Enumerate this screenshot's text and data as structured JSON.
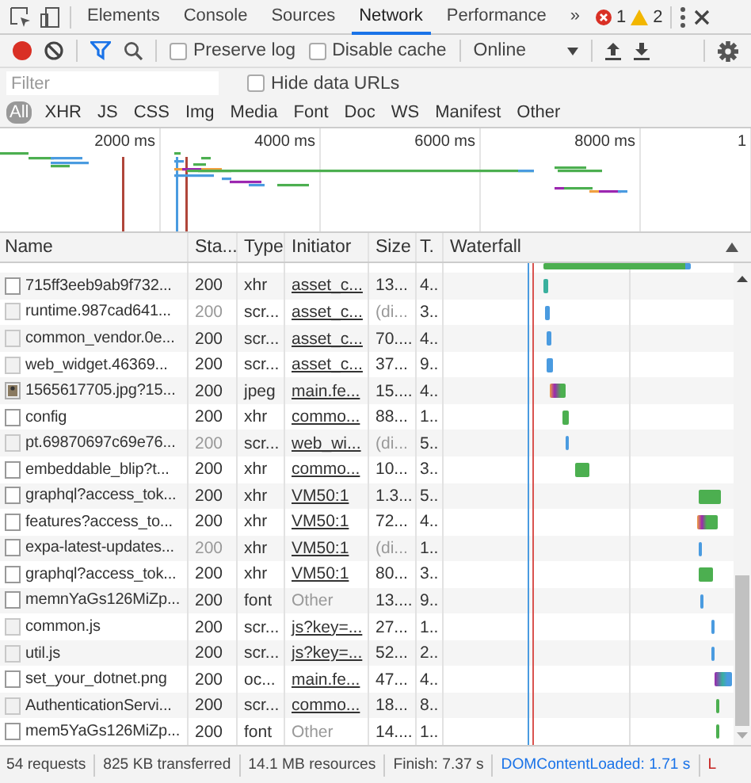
{
  "tabs": [
    {
      "label": "Elements",
      "selected": false
    },
    {
      "label": "Console",
      "selected": false
    },
    {
      "label": "Sources",
      "selected": false
    },
    {
      "label": "Network",
      "selected": true
    },
    {
      "label": "Performance",
      "selected": false
    }
  ],
  "overflow": "»",
  "errors": "1",
  "warnings": "2",
  "toolbar": {
    "recording": true,
    "filter_active": true,
    "checkboxes": [
      {
        "label": "Preserve log",
        "checked": false
      },
      {
        "label": "Disable cache",
        "checked": false
      }
    ],
    "throttling": "Online"
  },
  "filter": {
    "placeholder": "Filter",
    "hide_data_urls": {
      "label": "Hide data URLs",
      "checked": false
    }
  },
  "type_filters": [
    {
      "label": "All",
      "selected": true
    },
    {
      "label": "XHR",
      "selected": false
    },
    {
      "label": "JS",
      "selected": false
    },
    {
      "label": "CSS",
      "selected": false
    },
    {
      "label": "Img",
      "selected": false
    },
    {
      "label": "Media",
      "selected": false
    },
    {
      "label": "Font",
      "selected": false
    },
    {
      "label": "Doc",
      "selected": false
    },
    {
      "label": "WS",
      "selected": false
    },
    {
      "label": "Manifest",
      "selected": false
    },
    {
      "label": "Other",
      "selected": false
    }
  ],
  "overview": {
    "ticks": [
      "2000 ms",
      "4000 ms",
      "6000 ms",
      "8000 ms",
      "1"
    ]
  },
  "table": {
    "columns": [
      "Name",
      "Sta...",
      "Type",
      "Initiator",
      "Size",
      "T.",
      "Waterfall"
    ],
    "rows": [
      {
        "kind": "document",
        "name": "715ff3eeb9ab9f732...",
        "status": "200",
        "status_dim": false,
        "type": "xhr",
        "initiator": "asset_c...",
        "initiator_link": true,
        "size": "13...",
        "size_dim": false,
        "time": "4.."
      },
      {
        "kind": "script",
        "name": "runtime.987cad641...",
        "status": "200",
        "status_dim": true,
        "type": "scr...",
        "initiator": "asset_c...",
        "initiator_link": true,
        "size": "(di...",
        "size_dim": true,
        "time": "3.."
      },
      {
        "kind": "script",
        "name": "common_vendor.0e...",
        "status": "200",
        "status_dim": false,
        "type": "scr...",
        "initiator": "asset_c...",
        "initiator_link": true,
        "size": "70....",
        "size_dim": false,
        "time": "4.."
      },
      {
        "kind": "script",
        "name": "web_widget.46369...",
        "status": "200",
        "status_dim": false,
        "type": "scr...",
        "initiator": "asset_c...",
        "initiator_link": true,
        "size": "37...",
        "size_dim": false,
        "time": "9.."
      },
      {
        "kind": "image",
        "name": "1565617705.jpg?15...",
        "status": "200",
        "status_dim": false,
        "type": "jpeg",
        "initiator": "main.fe...",
        "initiator_link": true,
        "size": "15....",
        "size_dim": false,
        "time": "4.."
      },
      {
        "kind": "document",
        "name": "config",
        "status": "200",
        "status_dim": false,
        "type": "xhr",
        "initiator": "commo...",
        "initiator_link": true,
        "size": "88...",
        "size_dim": false,
        "time": "1.."
      },
      {
        "kind": "script",
        "name": "pt.69870697c69e76...",
        "status": "200",
        "status_dim": true,
        "type": "scr...",
        "initiator": "web_wi...",
        "initiator_link": true,
        "size": "(di...",
        "size_dim": true,
        "time": "5.."
      },
      {
        "kind": "document",
        "name": "embeddable_blip?t...",
        "status": "200",
        "status_dim": false,
        "type": "xhr",
        "initiator": "commo...",
        "initiator_link": true,
        "size": "10...",
        "size_dim": false,
        "time": "3.."
      },
      {
        "kind": "document",
        "name": "graphql?access_tok...",
        "status": "200",
        "status_dim": false,
        "type": "xhr",
        "initiator": "VM50:1",
        "initiator_link": true,
        "size": "1.3...",
        "size_dim": false,
        "time": "5.."
      },
      {
        "kind": "document",
        "name": "features?access_to...",
        "status": "200",
        "status_dim": false,
        "type": "xhr",
        "initiator": "VM50:1",
        "initiator_link": true,
        "size": "72...",
        "size_dim": false,
        "time": "4.."
      },
      {
        "kind": "document",
        "name": "expa-latest-updates...",
        "status": "200",
        "status_dim": true,
        "type": "xhr",
        "initiator": "VM50:1",
        "initiator_link": true,
        "size": "(di...",
        "size_dim": true,
        "time": "1.."
      },
      {
        "kind": "document",
        "name": "graphql?access_tok...",
        "status": "200",
        "status_dim": false,
        "type": "xhr",
        "initiator": "VM50:1",
        "initiator_link": true,
        "size": "80...",
        "size_dim": false,
        "time": "3.."
      },
      {
        "kind": "document",
        "name": "memnYaGs126MiZp...",
        "status": "200",
        "status_dim": false,
        "type": "font",
        "initiator": "Other",
        "initiator_link": false,
        "size": "13....",
        "size_dim": false,
        "time": "9.."
      },
      {
        "kind": "script",
        "name": "common.js",
        "status": "200",
        "status_dim": false,
        "type": "scr...",
        "initiator": "js?key=...",
        "initiator_link": true,
        "size": "27...",
        "size_dim": false,
        "time": "1.."
      },
      {
        "kind": "script",
        "name": "util.js",
        "status": "200",
        "status_dim": false,
        "type": "scr...",
        "initiator": "js?key=...",
        "initiator_link": true,
        "size": "52...",
        "size_dim": false,
        "time": "2.."
      },
      {
        "kind": "document",
        "name": "set_your_dotnet.png",
        "status": "200",
        "status_dim": false,
        "type": "oc...",
        "initiator": "main.fe...",
        "initiator_link": true,
        "size": "47...",
        "size_dim": false,
        "time": "4.."
      },
      {
        "kind": "script",
        "name": "AuthenticationServi...",
        "status": "200",
        "status_dim": false,
        "type": "scr...",
        "initiator": "commo...",
        "initiator_link": true,
        "size": "18...",
        "size_dim": false,
        "time": "8.."
      },
      {
        "kind": "document",
        "name": "mem5YaGs126MiZp...",
        "status": "200",
        "status_dim": false,
        "type": "font",
        "initiator": "Other",
        "initiator_link": false,
        "size": "14....",
        "size_dim": false,
        "time": "1.."
      }
    ]
  },
  "status_bar": [
    {
      "kind": "plain",
      "text": "54 requests"
    },
    {
      "kind": "plain",
      "text": "825 KB transferred"
    },
    {
      "kind": "plain",
      "text": "14.1 MB resources"
    },
    {
      "kind": "plain",
      "text": "Finish: 7.37 s"
    },
    {
      "kind": "dom",
      "text": "DOMContentLoaded: 1.71 s"
    },
    {
      "kind": "load",
      "text": "L"
    }
  ]
}
